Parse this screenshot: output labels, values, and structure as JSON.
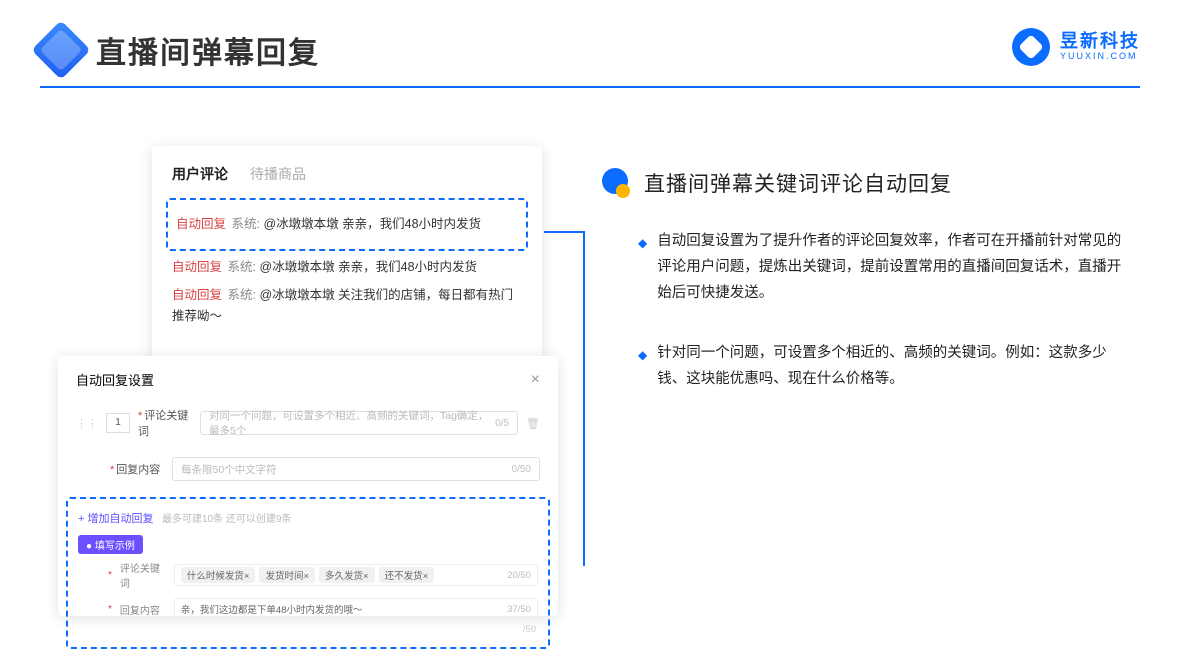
{
  "header": {
    "title": "直播间弹幕回复"
  },
  "brand": {
    "name": "昱新科技",
    "sub": "YUUXIN.COM"
  },
  "comments": {
    "tabs": {
      "active": "用户评论",
      "inactive": "待播商品"
    },
    "rows": [
      {
        "tag": "自动回复",
        "sys": "系统:",
        "text": "@冰墩墩本墩 亲亲，我们48小时内发货"
      },
      {
        "tag": "自动回复",
        "sys": "系统:",
        "text": "@冰墩墩本墩 亲亲，我们48小时内发货"
      },
      {
        "tag": "自动回复",
        "sys": "系统:",
        "text": "@冰墩墩本墩 关注我们的店铺，每日都有热门推荐呦～"
      }
    ]
  },
  "settings": {
    "title": "自动回复设置",
    "index": "1",
    "kw_label": "评论关键词",
    "kw_placeholder": "对同一个问题，可设置多个相近、高频的关键词，Tag确定，最多5个",
    "kw_count": "0/5",
    "reply_label": "回复内容",
    "reply_placeholder": "每条限50个中文字符",
    "reply_count": "0/50",
    "add_link": "+ 增加自动回复",
    "add_note": "最多可建10条 还可以创建9条",
    "example_pill": "● 填写示例",
    "ex_kw_label": "评论关键词",
    "ex_chips": [
      "什么时候发货×",
      "发货时间×",
      "多久发货×",
      "还不发货×"
    ],
    "ex_kw_count": "20/50",
    "ex_reply_label": "回复内容",
    "ex_reply_text": "亲，我们这边都是下单48小时内发货的哦～",
    "ex_reply_count": "37/50",
    "outer_count": "/50"
  },
  "right": {
    "section_title": "直播间弹幕关键词评论自动回复",
    "bullets": [
      "自动回复设置为了提升作者的评论回复效率，作者可在开播前针对常见的评论用户问题，提炼出关键词，提前设置常用的直播间回复话术，直播开始后可快捷发送。",
      "针对同一个问题，可设置多个相近的、高频的关键词。例如：这款多少钱、这块能优惠吗、现在什么价格等。"
    ]
  }
}
